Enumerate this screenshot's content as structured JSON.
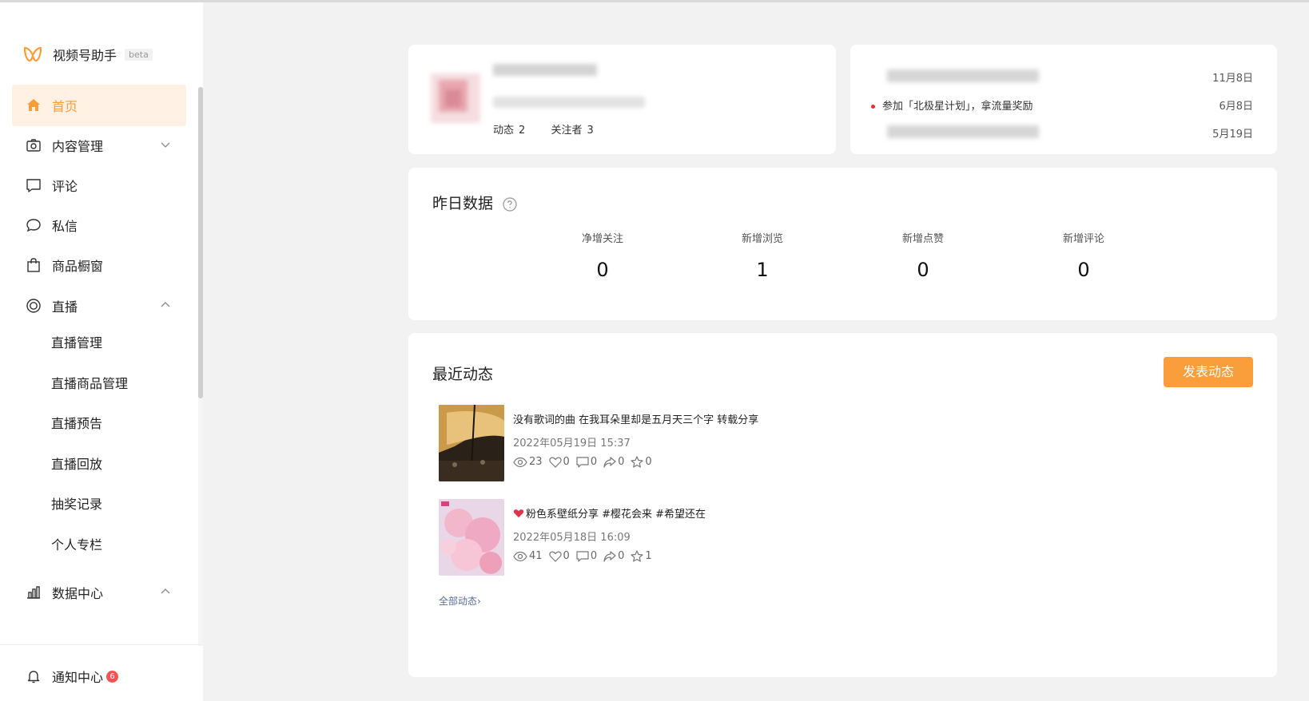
{
  "app": {
    "name": "视频号助手",
    "beta": "beta"
  },
  "sidebar": {
    "items": [
      {
        "label": "首页"
      },
      {
        "label": "内容管理"
      },
      {
        "label": "评论"
      },
      {
        "label": "私信"
      },
      {
        "label": "商品橱窗"
      },
      {
        "label": "直播"
      },
      {
        "label": "数据中心"
      }
    ],
    "live_sub": [
      "直播管理",
      "直播商品管理",
      "直播预告",
      "直播回放",
      "抽奖记录",
      "个人专栏"
    ],
    "notice": {
      "label": "通知中心",
      "badge": "6"
    }
  },
  "profile": {
    "dynamics_label": "动态",
    "dynamics_count": "2",
    "followers_label": "关注者",
    "followers_count": "3"
  },
  "notices": [
    {
      "text": "",
      "date": "11月8日"
    },
    {
      "text": "参加「北极星计划」，拿流量奖励",
      "date": "6月8日"
    },
    {
      "text": "",
      "date": "5月19日"
    }
  ],
  "yesterday": {
    "title": "昨日数据",
    "metrics": [
      {
        "label": "净增关注",
        "value": "0"
      },
      {
        "label": "新增浏览",
        "value": "1"
      },
      {
        "label": "新增点赞",
        "value": "0"
      },
      {
        "label": "新增评论",
        "value": "0"
      }
    ]
  },
  "recent": {
    "title": "最近动态",
    "publish_label": "发表动态",
    "all_label": "全部动态›",
    "posts": [
      {
        "title": "没有歌词的曲 在我耳朵里却是五月天三个字 转载分享",
        "time": "2022年05月19日 15:37",
        "views": "23",
        "likes": "0",
        "comments": "0",
        "shares": "0",
        "favs": "0"
      },
      {
        "title": "粉色系壁纸分享 #樱花会来 #希望还在",
        "time": "2022年05月18日 16:09",
        "views": "41",
        "likes": "0",
        "comments": "0",
        "shares": "0",
        "favs": "1"
      }
    ]
  },
  "colors": {
    "accent": "#fa9d3b",
    "active_bg": "#fff1e4",
    "link": "#576b95",
    "badge": "#fa5151"
  }
}
